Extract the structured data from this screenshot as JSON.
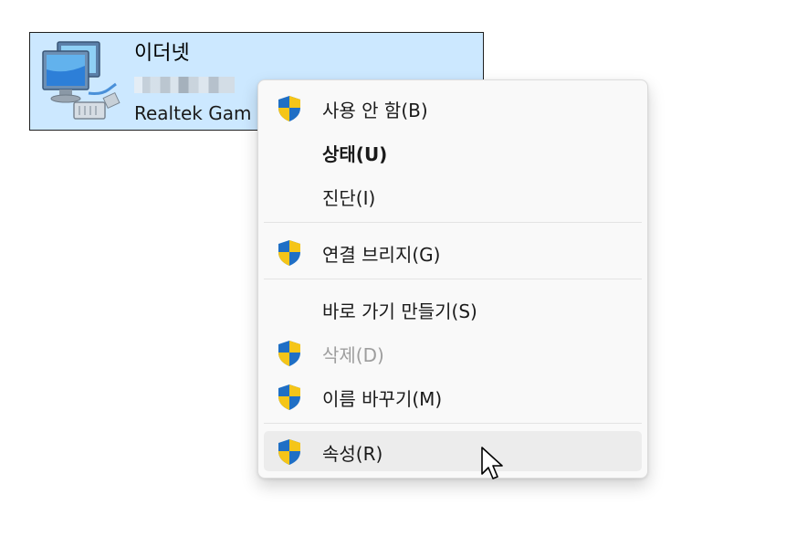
{
  "adapter": {
    "name": "이더넷",
    "device": "Realtek Gam",
    "status_redacted": true,
    "highlight_color": "#cce8ff"
  },
  "context_menu": {
    "items": [
      {
        "label": "사용 안 함(B)",
        "icon": "uac-shield-icon",
        "bold": false,
        "disabled": false
      },
      {
        "label": "상태(U)",
        "icon": null,
        "bold": true,
        "disabled": false
      },
      {
        "label": "진단(I)",
        "icon": null,
        "bold": false,
        "disabled": false
      },
      {
        "label": "연결 브리지(G)",
        "icon": "uac-shield-icon",
        "bold": false,
        "disabled": false
      },
      {
        "label": "바로 가기 만들기(S)",
        "icon": null,
        "bold": false,
        "disabled": false
      },
      {
        "label": "삭제(D)",
        "icon": "uac-shield-icon",
        "bold": false,
        "disabled": true
      },
      {
        "label": "이름 바꾸기(M)",
        "icon": "uac-shield-icon",
        "bold": false,
        "disabled": false
      },
      {
        "label": "속성(R)",
        "icon": "uac-shield-icon",
        "bold": false,
        "disabled": false,
        "hovered": true
      }
    ]
  },
  "cursor": {
    "icon": "arrow-cursor-icon"
  }
}
